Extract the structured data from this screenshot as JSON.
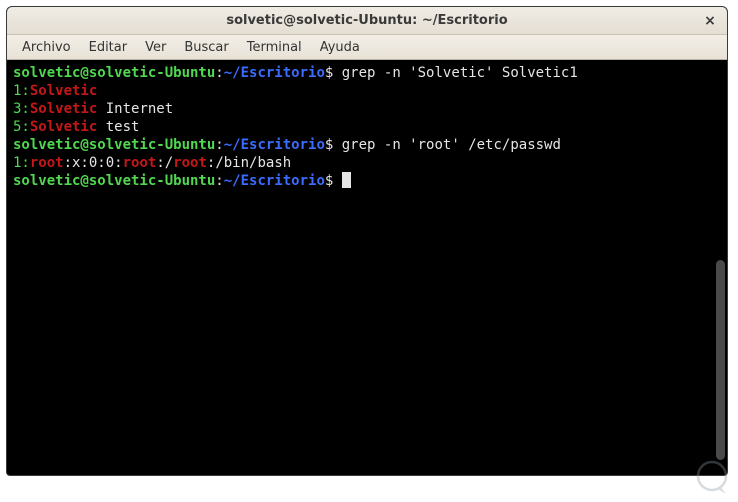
{
  "window": {
    "title": "solvetic@solvetic-Ubuntu: ~/Escritorio",
    "close_glyph": "×"
  },
  "menu": {
    "items": [
      "Archivo",
      "Editar",
      "Ver",
      "Buscar",
      "Terminal",
      "Ayuda"
    ]
  },
  "prompt": {
    "user_host": "solvetic@solvetic-Ubuntu",
    "sep": ":",
    "path": "~/Escritorio",
    "sigil": "$"
  },
  "lines": {
    "cmd1": " grep -n 'Solvetic' Solvetic1",
    "r1_num": "1:",
    "r1_match": "Solvetic",
    "r2_num": "3:",
    "r2_match": "Solvetic",
    "r2_rest": " Internet",
    "r3_num": "5:",
    "r3_match": "Solvetic",
    "r3_rest": " test",
    "cmd2": " grep -n 'root' /etc/passwd",
    "p_num": "1:",
    "p_m1": "root",
    "p_t1": ":x:0:0:",
    "p_m2": "root",
    "p_t2": ":/",
    "p_m3": "root",
    "p_t3": ":/bin/bash"
  }
}
